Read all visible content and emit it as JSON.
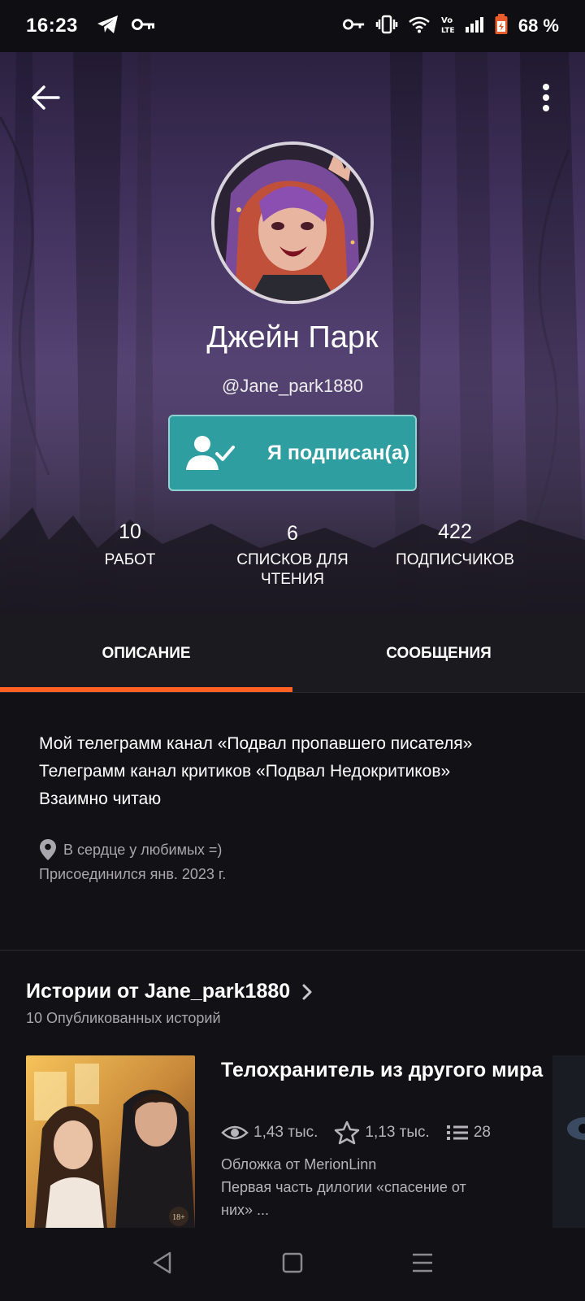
{
  "status_bar": {
    "time": "16:23",
    "battery": "68 %"
  },
  "profile": {
    "name": "Джейн Парк",
    "handle": "@Jane_park1880",
    "follow_label": "Я подписан(а)"
  },
  "stats": [
    {
      "number": "10",
      "label_lines": [
        "РАБОТ"
      ]
    },
    {
      "number": "6",
      "label_lines": [
        "СПИСКОВ ДЛЯ",
        "ЧТЕНИЯ"
      ]
    },
    {
      "number": "422",
      "label_lines": [
        "ПОДПИСЧИКОВ"
      ]
    }
  ],
  "tabs": [
    {
      "label": "ОПИСАНИЕ",
      "active": true
    },
    {
      "label": "СООБЩЕНИЯ",
      "active": false
    }
  ],
  "description": {
    "lines": [
      "Мой телеграмм канал «Подвал пропавшего писателя»",
      "Телеграмм канал критиков «Подвал Недокритиков»",
      "Взаимно читаю"
    ],
    "location": "В сердце у любимых =)",
    "joined": "Присоединился янв. 2023 г."
  },
  "stories": {
    "title": "Истории от Jane_park1880",
    "subtitle": "10 Опубликованных историй",
    "items": [
      {
        "title": "Телохранитель из другого мира",
        "views": "1,43 тыс.",
        "votes": "1,13 тыс.",
        "parts": "28",
        "cover_credit": "Обложка от MerionLinn",
        "desc_line1": "Первая часть дилогии «спасение от",
        "desc_line2": "них» ...",
        "cover_badge": "18+"
      }
    ]
  },
  "colors": {
    "accent": "#ff6122",
    "follow_button": "#2f9ea0",
    "background": "#121116"
  }
}
